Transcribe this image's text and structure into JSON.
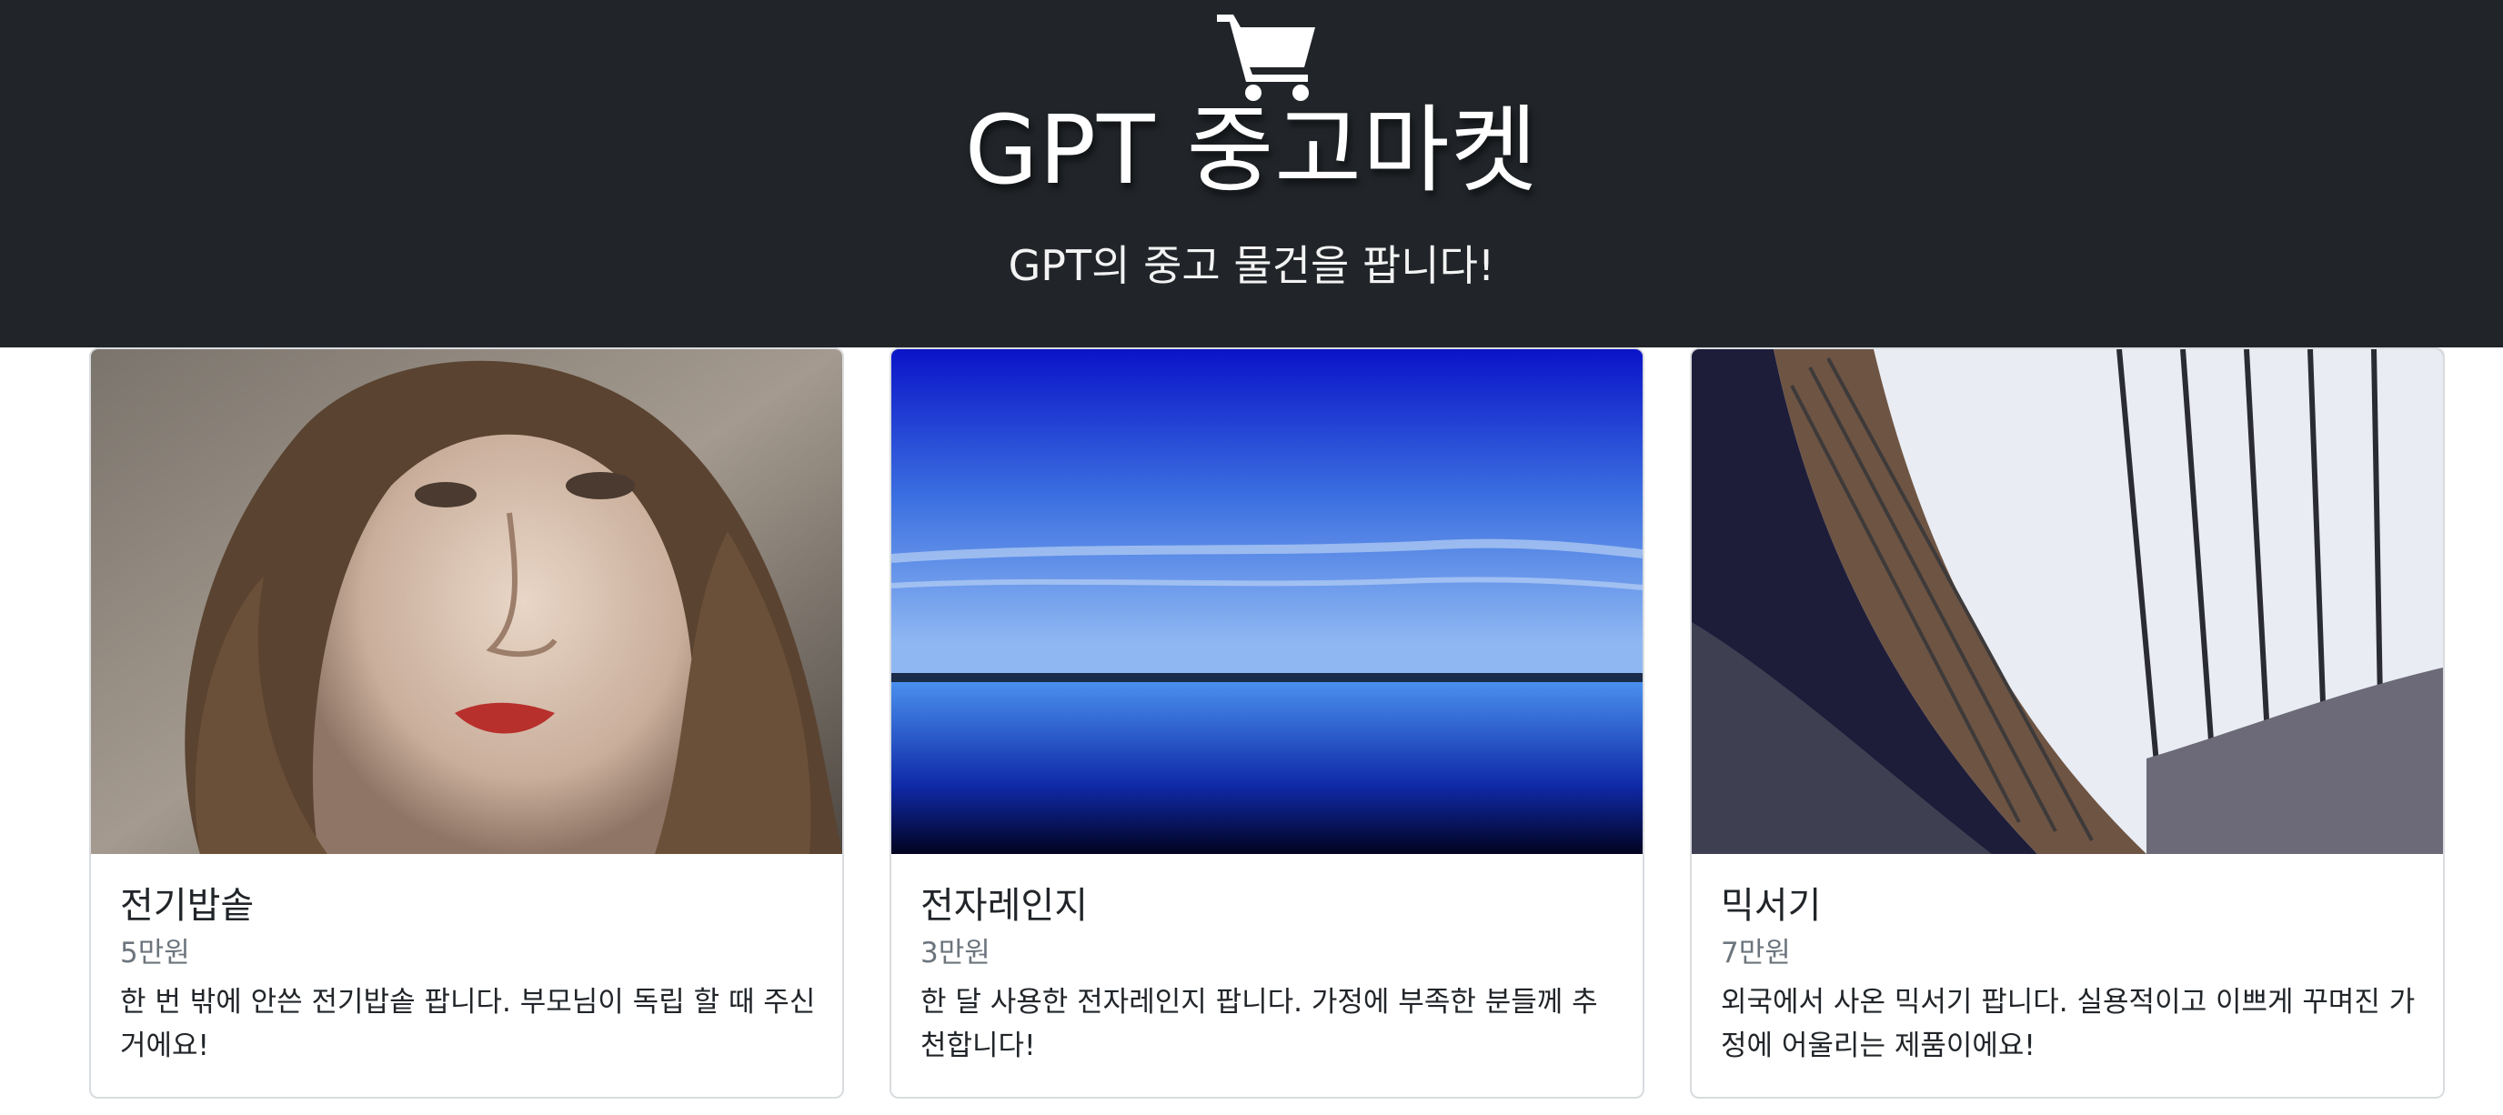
{
  "header": {
    "icon": "shopping-cart-icon",
    "title": "GPT 중고마켓",
    "subtitle": "GPT의 중고 물건을 팝니다!",
    "background_color": "#212529"
  },
  "products": [
    {
      "image": "woman-portrait-photo",
      "name": "전기밥솥",
      "price": "5만원",
      "description": "한 번 밖에 안쓴 전기밥솥 팝니다. 부모님이 독립 할 때 주신 거에요!"
    },
    {
      "image": "blue-lake-horizon-photo",
      "name": "전자레인지",
      "price": "3만원",
      "description": "한 달 사용한 전자레인지 팝니다. 가정에 부족한 분들께 추천합니다!"
    },
    {
      "image": "curved-library-bookshelves-photo",
      "name": "믹서기",
      "price": "7만원",
      "description": "외국에서 사온 믹서기 팝니다. 실용적이고 이쁘게 꾸며진 가정에 어울리는 제품이에요!"
    }
  ]
}
